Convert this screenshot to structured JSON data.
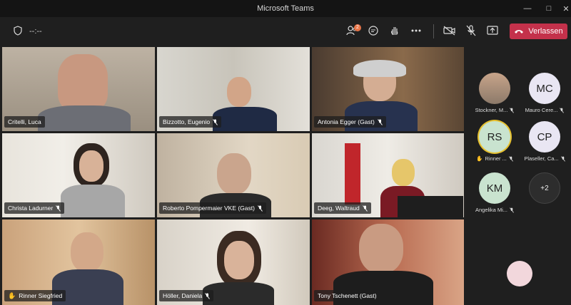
{
  "window": {
    "title": "Microsoft Teams"
  },
  "toolbar": {
    "timer": "--:--",
    "participants_badge": "2",
    "leave_label": "Verlassen"
  },
  "tiles": [
    {
      "name": "Critelli, Luca"
    },
    {
      "name": "Bizzotto, Eugenio"
    },
    {
      "name": "Antonia Egger (Gast)"
    },
    {
      "name": "Christa Ladurner"
    },
    {
      "name": "Roberto Pompermaier VKE (Gast)"
    },
    {
      "name": "Deeg, Waltraud"
    },
    {
      "name": "Rinner Siegfried"
    },
    {
      "name": "Höller, Daniela"
    },
    {
      "name": "Tony Tschenett (Gast)"
    }
  ],
  "side_participants": [
    {
      "initials": "",
      "name": "Stockner, M..."
    },
    {
      "initials": "MC",
      "name": "Mauro Cere..."
    },
    {
      "initials": "RS",
      "name": "Rinner ..."
    },
    {
      "initials": "CP",
      "name": "Plaseller, Ca..."
    },
    {
      "initials": "KM",
      "name": "Angelika Mi..."
    },
    {
      "initials": "+2",
      "name": ""
    }
  ],
  "colors": {
    "leave": "#c4314b",
    "avatar": "#e9e6f3",
    "avatar_green": "#c9e3cf"
  }
}
